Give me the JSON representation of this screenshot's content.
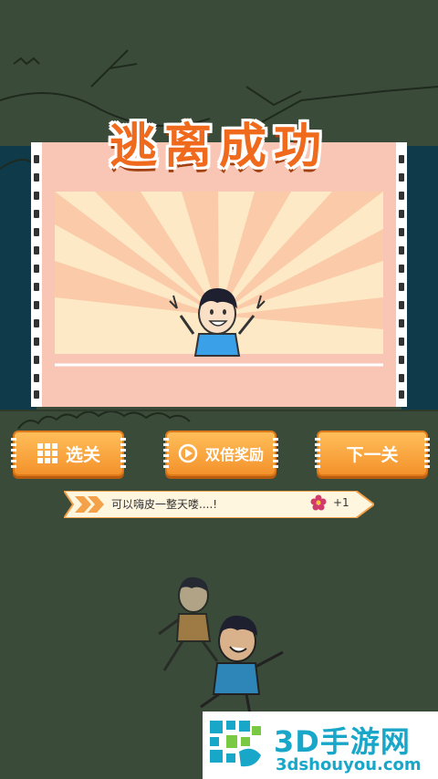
{
  "title": "逃离成功",
  "buttons": {
    "level_select": "选关",
    "double_reward": "双倍奖励",
    "next_level": "下一关"
  },
  "banner": {
    "message": "可以嗨皮一整天喽....!",
    "reward": "+1",
    "reward_icon": "flower-icon"
  },
  "watermark": {
    "name": "3D手游网",
    "url": "3dshouyou.com"
  },
  "colors": {
    "accent": "#f4922c",
    "title": "#f06a1e",
    "background": "#3b4b39",
    "frame_pink": "#f7c2b1",
    "brand": "#18a7c8"
  }
}
